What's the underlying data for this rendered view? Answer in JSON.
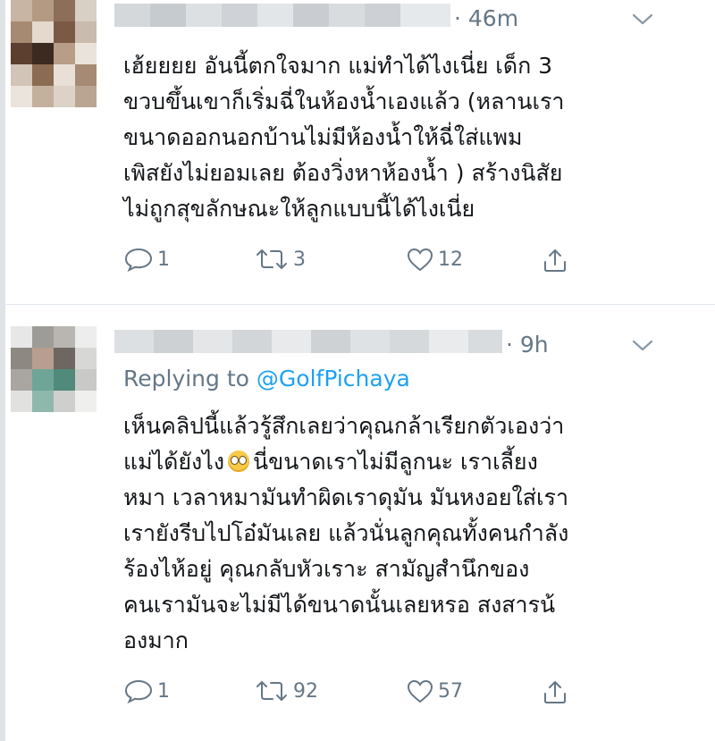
{
  "tweets": [
    {
      "time": "· 46m",
      "body_lines": [
        "เฮ้ยยยย อันนี้ตกใจมาก แม่ทำได้ไงเนี่ย เด็ก 3",
        "ขวบขึ้นเขาก็เริ่มฉี่ในห้องน้ำเองแล้ว (หลานเรา",
        "ขนาดออกนอกบ้านไม่มีห้องน้ำให้ฉี่ใส่แพม",
        "เพิสยังไม่ยอมเลย ต้องวิ่งหาห้องน้ำ ) สร้างนิสัย",
        "ไม่ถูกสุขลักษณะให้ลูกแบบนี้ได้ไงเนี่ย"
      ],
      "replies": "1",
      "retweets": "3",
      "likes": "12"
    },
    {
      "time": "· 9h",
      "replying_prefix": "Replying to",
      "replying_handle": "@GolfPichaya",
      "body_lines": [
        "เห็นคลิปนี้แล้วรู้สึกเลยว่าคุณกล้าเรียกตัวเองว่า",
        "แม่ได้ยังไง",
        "หมา เวลาหมามันทำผิดเราดุมัน มันหงอยใส่เรา",
        "เรายังรีบไปโอ๋มันเลย แล้วนั่นลูกคุณทั้งคนกำลัง",
        "ร้องไห้อยู่ คุณกลับหัวเราะ สามัญสำนึกของ",
        "คนเรามันจะไม่มีได้ขนาดนั้นเลยหรอ สงสารน้",
        "องมาก"
      ],
      "line2_after_emoji": "นี่ขนาดเราไม่มีลูกนะ เราเลี้ยง",
      "replies": "1",
      "retweets": "92",
      "likes": "57"
    }
  ],
  "colors": {
    "text": "#14171a",
    "muted": "#657786",
    "link": "#1da1f2",
    "divider": "#e1e8ed"
  },
  "icons": [
    "reply-icon",
    "retweet-icon",
    "like-icon",
    "share-icon",
    "chevron-down-icon",
    "rolling-eyes-emoji"
  ]
}
